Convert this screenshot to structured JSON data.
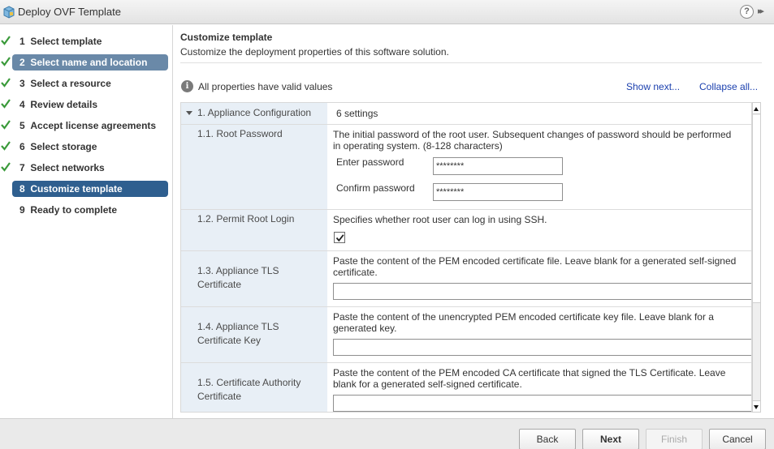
{
  "window": {
    "title": "Deploy OVF Template",
    "help_glyph": "?",
    "forward_glyph": "▸▸"
  },
  "steps": [
    {
      "num": "1",
      "label": "Select template",
      "done": true
    },
    {
      "num": "2",
      "label": "Select name and location",
      "done": true,
      "selected": true
    },
    {
      "num": "3",
      "label": "Select a resource",
      "done": true
    },
    {
      "num": "4",
      "label": "Review details",
      "done": true
    },
    {
      "num": "5",
      "label": "Accept license agreements",
      "done": true
    },
    {
      "num": "6",
      "label": "Select storage",
      "done": true
    },
    {
      "num": "7",
      "label": "Select networks",
      "done": true
    },
    {
      "num": "8",
      "label": "Customize template",
      "done": false,
      "current": true
    },
    {
      "num": "9",
      "label": "Ready to complete",
      "done": false
    }
  ],
  "main": {
    "title": "Customize template",
    "subtitle": "Customize the deployment properties of this software solution.",
    "info_icon_glyph": "i",
    "validity_text": "All properties have valid values",
    "show_next": "Show next...",
    "collapse_all": "Collapse all..."
  },
  "grid": {
    "group": {
      "label": "1. Appliance Configuration",
      "settings": "6 settings"
    },
    "rows": {
      "root_password": {
        "label": "1.1. Root Password",
        "desc_line1": "The initial password of the root user. Subsequent changes of password should be performed",
        "desc_line2": "in operating system. (8-128 characters)",
        "enter_label": "Enter password",
        "enter_value": "********",
        "confirm_label": "Confirm password",
        "confirm_value": "********"
      },
      "permit_root": {
        "label": "1.2. Permit Root Login",
        "desc": "Specifies whether root user can log in using SSH.",
        "checked": true
      },
      "tls_cert": {
        "label_line1": "1.3. Appliance TLS",
        "label_line2": "Certificate",
        "desc_line1": "Paste the content of the PEM encoded certificate file. Leave blank for a generated self-signed",
        "desc_line2": "certificate."
      },
      "tls_key": {
        "label_line1": "1.4. Appliance TLS",
        "label_line2": "Certificate Key",
        "desc_line1": "Paste the content of the unencrypted PEM encoded certificate key file. Leave blank for a",
        "desc_line2": "generated key."
      },
      "ca_cert": {
        "label_line1": "1.5. Certificate Authority",
        "label_line2": "Certificate",
        "desc_line1": "Paste the content of the PEM encoded CA certificate that signed the TLS Certificate. Leave",
        "desc_line2": "blank for a generated self-signed certificate."
      }
    }
  },
  "footer": {
    "back": "Back",
    "next": "Next",
    "finish": "Finish",
    "cancel": "Cancel"
  },
  "colors": {
    "accent": "#2f5f8f",
    "visited": "#6a89a8",
    "check": "#3a9a3a",
    "link": "#1a3fae"
  }
}
